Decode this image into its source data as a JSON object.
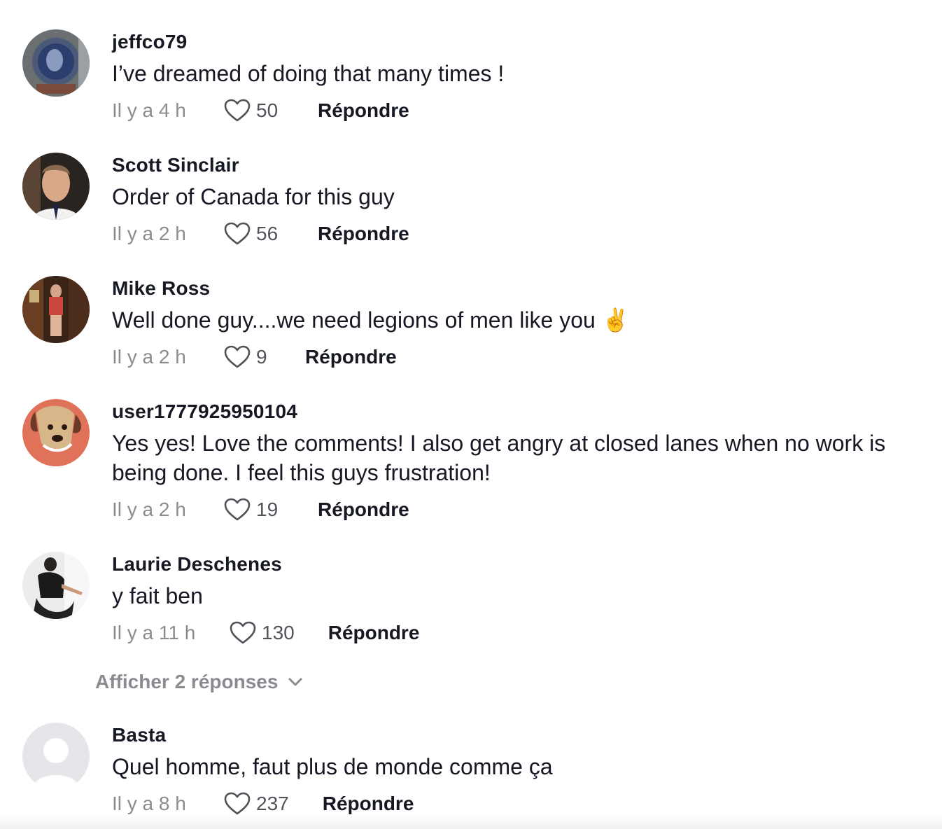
{
  "comments": [
    {
      "username": "jeffco79",
      "text": "I’ve dreamed of doing that many times !",
      "time": "Il y a 4 h",
      "likes": "50",
      "reply_label": "Répondre"
    },
    {
      "username": "Scott Sinclair",
      "text": "Order of Canada for this guy",
      "time": "Il y a 2 h",
      "likes": "56",
      "reply_label": "Répondre"
    },
    {
      "username": "Mike Ross",
      "text": "Well done guy....we need legions of men like you ✌️",
      "time": "Il y a 2 h",
      "likes": "9",
      "reply_label": "Répondre"
    },
    {
      "username": "user1777925950104",
      "text": "Yes yes! Love the comments! I also get angry at closed lanes when no work is being done. I feel this guys frustration!",
      "time": "Il y a 2 h",
      "likes": "19",
      "reply_label": "Répondre"
    },
    {
      "username": "Laurie Deschenes",
      "text": "y fait ben",
      "time": "Il y a 11 h",
      "likes": "130",
      "reply_label": "Répondre"
    },
    {
      "username": "Basta",
      "text": "Quel homme, faut plus de monde comme ça",
      "time": "Il y a 8 h",
      "likes": "237",
      "reply_label": "Répondre"
    }
  ],
  "view_replies_label": "Afficher 2 réponses",
  "colors": {
    "text_primary": "#161823",
    "text_secondary": "rgba(22,24,35,0.5)",
    "background": "#ffffff"
  },
  "icons": {
    "like": "heart-outline-icon",
    "expand": "chevron-down-icon"
  }
}
